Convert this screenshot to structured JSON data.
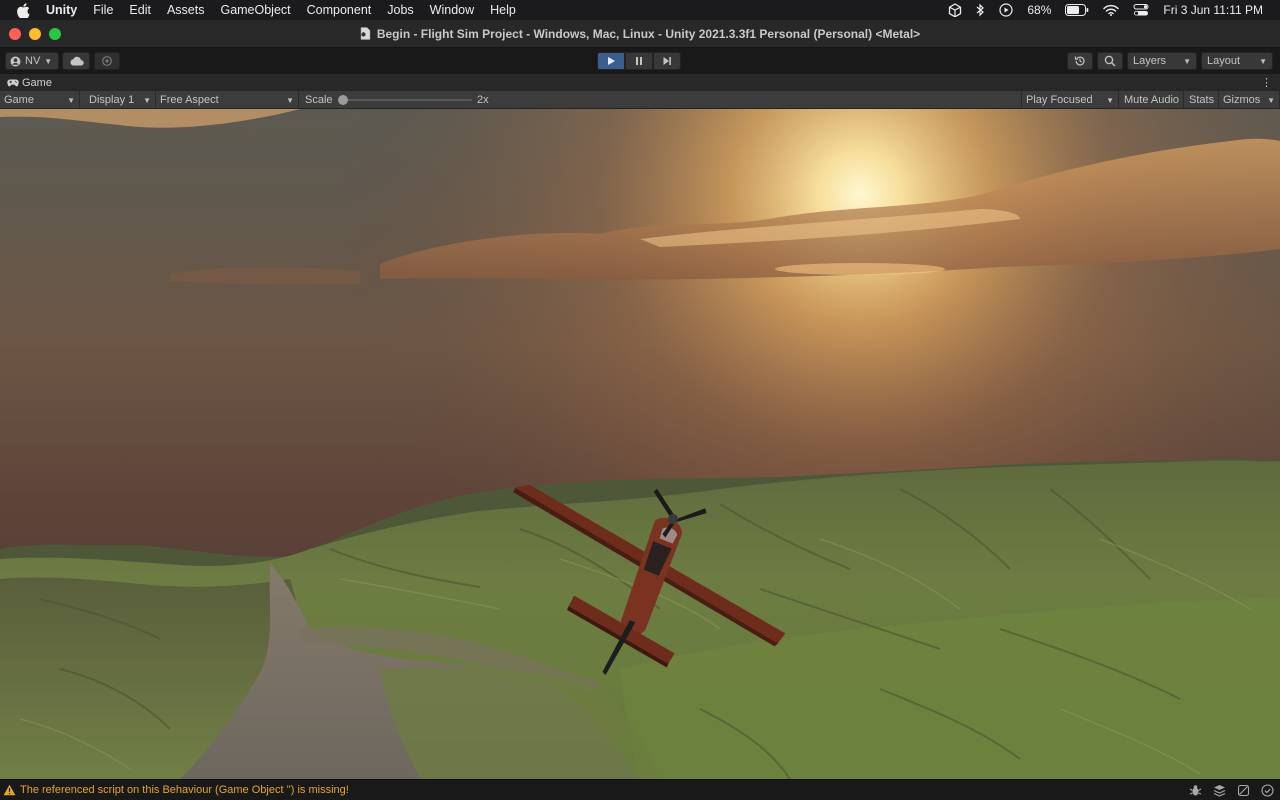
{
  "menubar": {
    "app_name": "Unity",
    "items": [
      "File",
      "Edit",
      "Assets",
      "GameObject",
      "Component",
      "Jobs",
      "Window",
      "Help"
    ],
    "battery": "68%",
    "datetime": "Fri 3 Jun  11:11 PM"
  },
  "window": {
    "title": "Begin - Flight Sim Project - Windows, Mac, Linux - Unity 2021.3.3f1 Personal (Personal) <Metal>"
  },
  "toolbar": {
    "account_label": "NV",
    "layers_label": "Layers",
    "layout_label": "Layout"
  },
  "game_tab": {
    "label": "Game"
  },
  "control_bar": {
    "view_mode": "Game",
    "display": "Display 1",
    "aspect": "Free Aspect",
    "scale_label": "Scale",
    "scale_value": "2x",
    "scale_level": 0.0,
    "play_mode": "Play Focused",
    "mute_label": "Mute Audio",
    "stats_label": "Stats",
    "gizmos_label": "Gizmos"
  },
  "status": {
    "message": "The referenced script on this Behaviour (Game Object '') is missing!",
    "warning_color": "#e6a530"
  },
  "colors": {
    "play_active": "#3c5e8c",
    "menubar_bg": "#1b1a1d",
    "editor_bg": "#282828"
  }
}
